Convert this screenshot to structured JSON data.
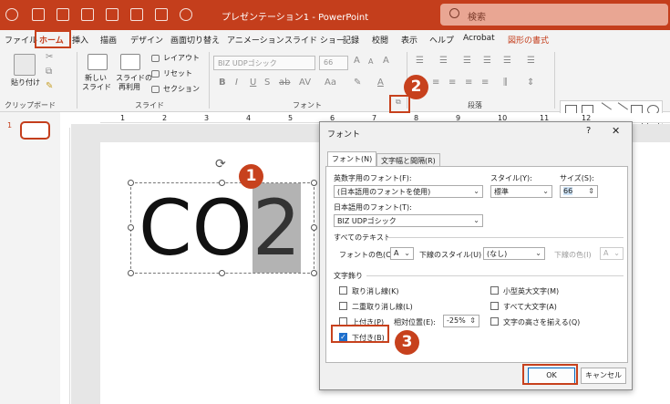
{
  "window": {
    "title": "プレゼンテーション1 - PowerPoint",
    "search_placeholder": "検索"
  },
  "tabs": [
    "ファイル",
    "ホーム",
    "挿入",
    "描画",
    "デザイン",
    "画面切り替え",
    "アニメーション",
    "スライド ショー",
    "記録",
    "校閲",
    "表示",
    "ヘルプ",
    "Acrobat",
    "図形の書式"
  ],
  "ribbon": {
    "paste": "貼り付け",
    "clipboard": "クリップボード",
    "new_slide_1": "新しい",
    "new_slide_2": "スライド",
    "reuse_1": "スライドの",
    "reuse_2": "再利用",
    "layout": "レイアウト",
    "reset": "リセット",
    "section": "セクション",
    "slides": "スライド",
    "font_name": "BIZ UDPゴシック",
    "font_size": "66",
    "font": "フォント",
    "paragraph": "段落"
  },
  "thumbnail": {
    "number": "1"
  },
  "ruler_numbers": [
    "1",
    "2",
    "3",
    "4",
    "5",
    "6",
    "7",
    "8",
    "9",
    "10",
    "11",
    "12"
  ],
  "slide": {
    "text_main": "CO",
    "text_selected": "2"
  },
  "badges": [
    "1",
    "2",
    "3"
  ],
  "dialog": {
    "title": "フォント",
    "help": "?",
    "close": "✕",
    "tab_font": "フォント(N)",
    "tab_spacing": "文字幅と間隔(R)",
    "latin_font_label": "英数字用のフォント(F):",
    "latin_font_value": "(日本語用のフォントを使用)",
    "style_label": "スタイル(Y):",
    "style_value": "標準",
    "size_label": "サイズ(S):",
    "size_value": "66",
    "jp_font_label": "日本語用のフォント(T):",
    "jp_font_value": "BIZ UDPゴシック",
    "all_text": "すべてのテキスト",
    "font_color": "フォントの色(C)",
    "underline_style": "下線のスタイル(U)",
    "underline_value": "(なし)",
    "underline_color": "下線の色(I)",
    "effects": "文字飾り",
    "effects_left": [
      {
        "label": "取り消し線(K)",
        "checked": false
      },
      {
        "label": "二重取り消し線(L)",
        "checked": false
      },
      {
        "label": "上付き(P)",
        "checked": false
      },
      {
        "label": "下付き(B)",
        "checked": true
      }
    ],
    "effects_right": [
      {
        "label": "小型英大文字(M)",
        "checked": false
      },
      {
        "label": "すべて大文字(A)",
        "checked": false
      },
      {
        "label": "文字の高さを揃える(Q)",
        "checked": false
      }
    ],
    "offset_label": "相対位置(E):",
    "offset_value": "-25%",
    "ok": "OK",
    "cancel": "キャンセル"
  }
}
